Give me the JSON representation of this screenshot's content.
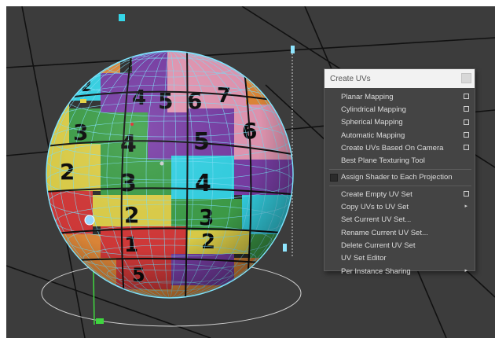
{
  "menu": {
    "title": "Create UVs",
    "items": [
      {
        "label": "Planar Mapping",
        "option_box": true
      },
      {
        "label": "Cylindrical Mapping",
        "option_box": true
      },
      {
        "label": "Spherical Mapping",
        "option_box": true
      },
      {
        "label": "Automatic Mapping",
        "option_box": true
      },
      {
        "label": "Create UVs Based On Camera",
        "option_box": true
      },
      {
        "label": "Best Plane Texturing Tool",
        "option_box": false
      },
      {
        "label": "Assign Shader to Each Projection",
        "checkbox": true
      },
      {
        "label": "Create Empty UV Set",
        "option_box": true
      },
      {
        "label": "Copy UVs to UV Set",
        "submenu": true
      },
      {
        "label": "Set Current UV Set...",
        "option_box": false
      },
      {
        "label": "Rename Current UV Set...",
        "option_box": false
      },
      {
        "label": "Delete Current UV Set",
        "option_box": false
      },
      {
        "label": "UV Set Editor",
        "option_box": false
      },
      {
        "label": "Per Instance Sharing",
        "submenu": true
      }
    ]
  },
  "sphere_numbers": {
    "row0": [
      "4",
      "5",
      "6",
      "7"
    ],
    "row0_edge": [
      "2"
    ],
    "row1": [
      "3",
      "4",
      "5",
      "6"
    ],
    "row2": [
      "2",
      "3",
      "4"
    ],
    "row3": [
      "2",
      "3"
    ],
    "row4": [
      "1",
      "2"
    ],
    "row5": [
      "5"
    ]
  },
  "colors": {
    "viewport_bg": "#3c3c3c",
    "wireframe": "#7fe5ff",
    "menu_bg": "#444444",
    "menu_title_bg": "#f2f2f2",
    "tile_purple": "#7b3fa8",
    "tile_pink": "#e89ab6",
    "tile_cyan": "#35d6e8",
    "tile_green": "#3fa14a",
    "tile_yellow": "#e2d34a",
    "tile_red": "#d83a3a",
    "tile_orange": "#e58b3a"
  }
}
